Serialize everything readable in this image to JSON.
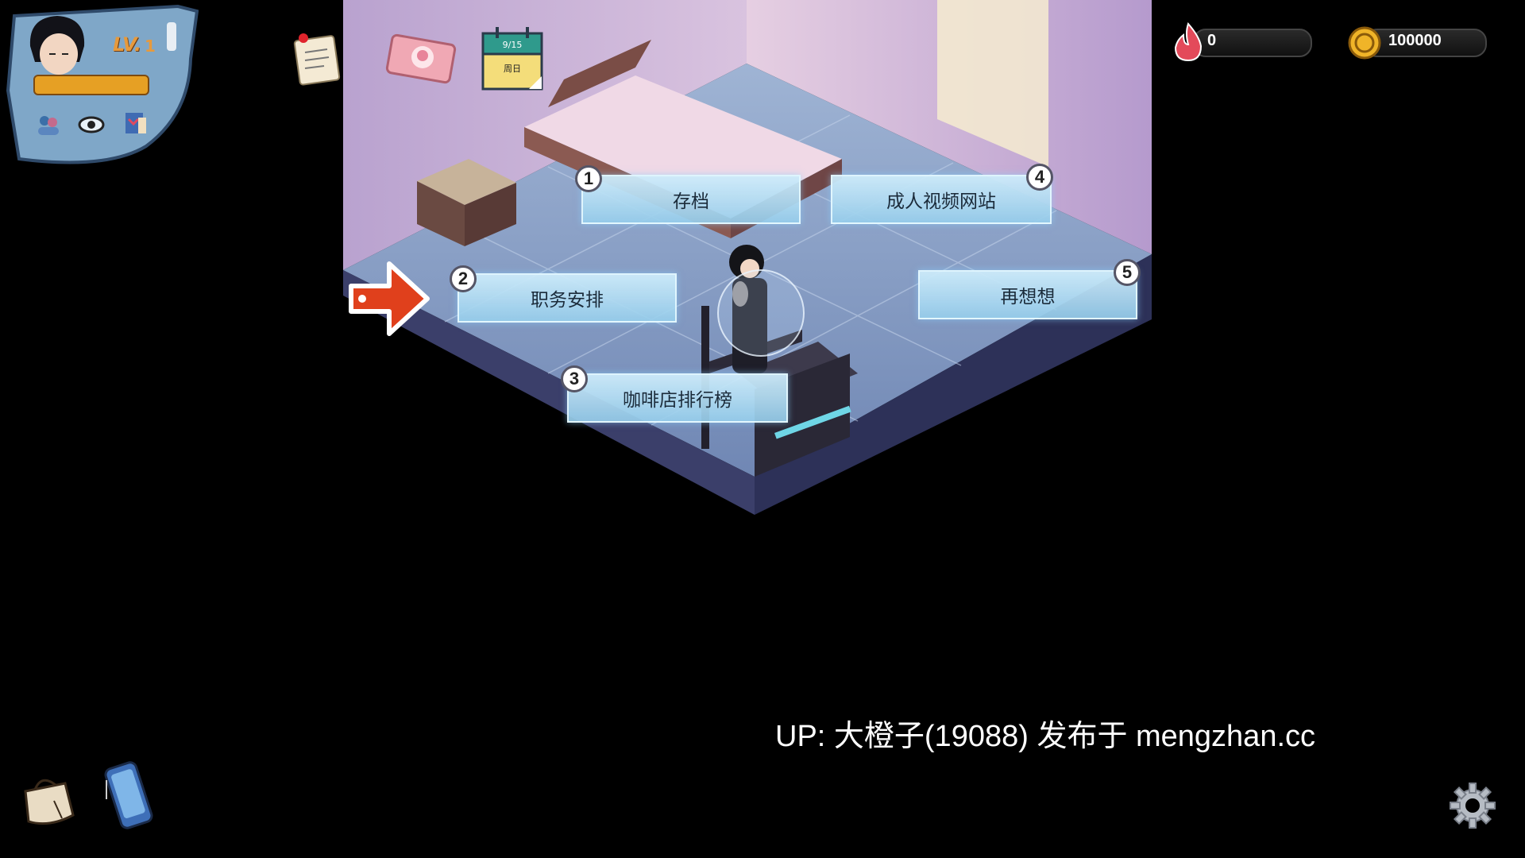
{
  "player": {
    "level_label": "LV.",
    "level": "1"
  },
  "calendar": {
    "date": "9/15",
    "weekday": "周日"
  },
  "resources": {
    "heat": "0",
    "coins": "100000"
  },
  "menu": {
    "items": [
      {
        "num": "1",
        "label": "存档"
      },
      {
        "num": "2",
        "label": "职务安排"
      },
      {
        "num": "3",
        "label": "咖啡店排行榜"
      },
      {
        "num": "4",
        "label": "成人视频网站"
      },
      {
        "num": "5",
        "label": "再想想"
      }
    ]
  },
  "watermark": "UP: 大橙子(19088) 发布于 mengzhan.cc",
  "colors": {
    "background": "#000000",
    "button_fill": "#b8def2",
    "button_text": "#1b2b3a",
    "accent_orange": "#e6a024",
    "arrow_red": "#e0401c"
  },
  "icons": [
    "avatar",
    "friends-icon",
    "eye-icon",
    "book-icon",
    "note-scroll-icon",
    "photo-card-icon",
    "calendar-icon",
    "flame-icon",
    "coin-icon",
    "pointer-arrow-icon",
    "bag-icon",
    "phone-icon",
    "gear-icon"
  ]
}
